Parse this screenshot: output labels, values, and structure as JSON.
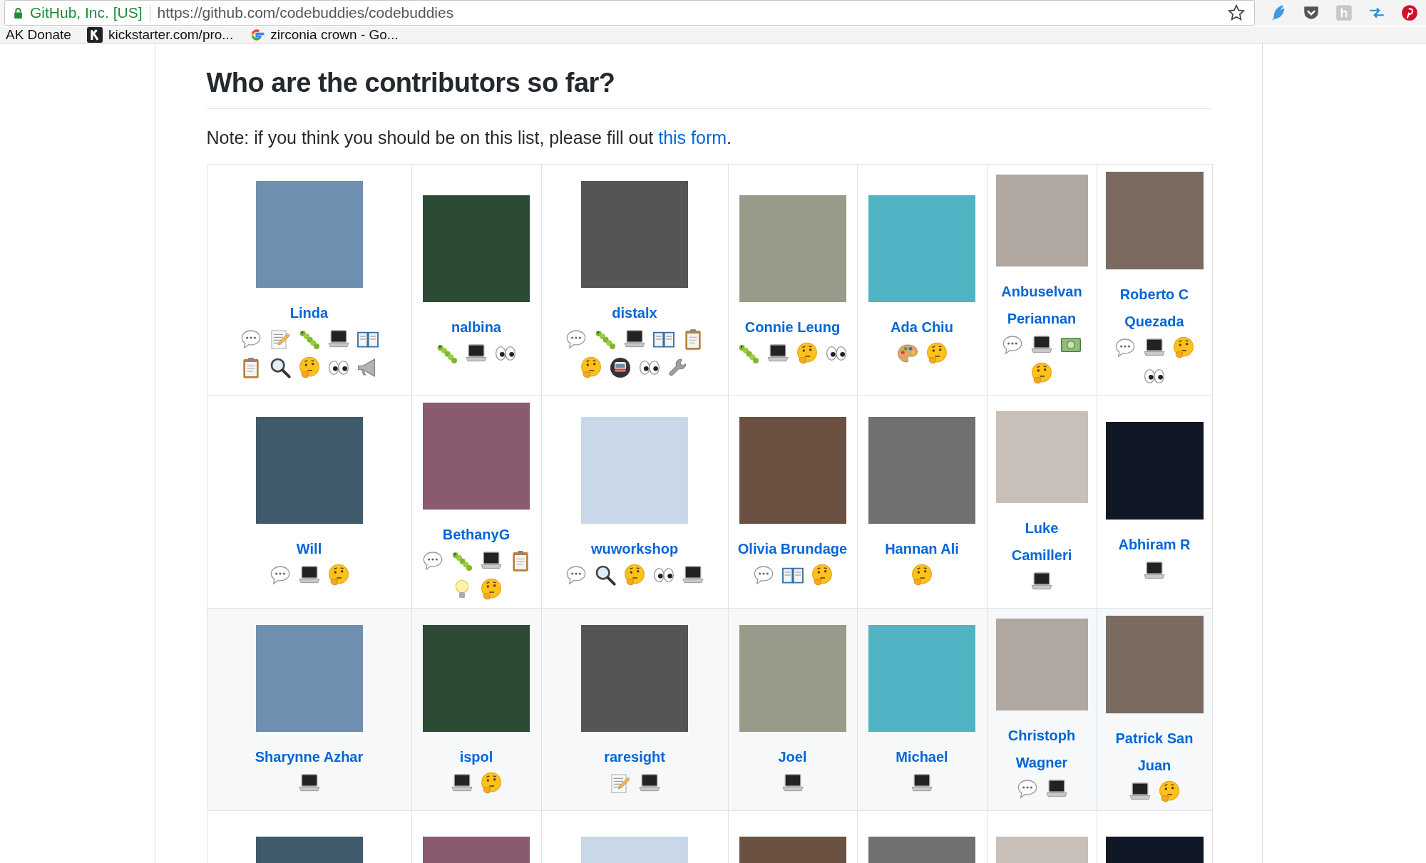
{
  "browser": {
    "site_identity": "GitHub, Inc. [US]",
    "url": "https://github.com/codebuddies/codebuddies",
    "bookmarks": [
      {
        "kind": "text",
        "label": "AK Donate"
      },
      {
        "kind": "kickstarter",
        "label": "kickstarter.com/pro..."
      },
      {
        "kind": "google",
        "label": "zirconia crown - Go..."
      }
    ]
  },
  "heading": "Who are the contributors so far?",
  "note": {
    "before": "Note: if you think you should be on this list, please fill out ",
    "link": "this form",
    "after": "."
  },
  "rows": [
    [
      {
        "name": "Linda",
        "contributions": [
          {
            "kind": "speech"
          },
          {
            "kind": "memo"
          },
          {
            "kind": "bug"
          },
          {
            "kind": "laptop"
          },
          {
            "kind": "book"
          },
          {
            "kind": "clipboard"
          },
          {
            "kind": "magnifier"
          },
          {
            "kind": "thinking"
          },
          {
            "kind": "eyes"
          },
          {
            "kind": "megaphone"
          }
        ]
      },
      {
        "name": "nalbina",
        "contributions": [
          {
            "kind": "bug"
          },
          {
            "kind": "laptop"
          },
          {
            "kind": "eyes"
          }
        ]
      },
      {
        "name": "distalx",
        "contributions": [
          {
            "kind": "speech"
          },
          {
            "kind": "bug"
          },
          {
            "kind": "laptop"
          },
          {
            "kind": "book"
          },
          {
            "kind": "clipboard"
          },
          {
            "kind": "thinking"
          },
          {
            "kind": "train"
          },
          {
            "kind": "eyes"
          },
          {
            "kind": "wrench"
          }
        ]
      },
      {
        "name": "Connie Leung",
        "contributions": [
          {
            "kind": "bug"
          },
          {
            "kind": "laptop"
          },
          {
            "kind": "thinking"
          },
          {
            "kind": "eyes"
          }
        ]
      },
      {
        "name": "Ada Chiu",
        "contributions": [
          {
            "kind": "palette"
          },
          {
            "kind": "thinking"
          }
        ]
      },
      {
        "name": "Anbuselvan Periannan",
        "contributions": [
          {
            "kind": "speech"
          },
          {
            "kind": "laptop"
          },
          {
            "kind": "money"
          },
          {
            "kind": "thinking"
          }
        ]
      },
      {
        "name": "Roberto C Quezada",
        "contributions": [
          {
            "kind": "speech"
          },
          {
            "kind": "laptop"
          },
          {
            "kind": "thinking"
          },
          {
            "kind": "eyes"
          }
        ]
      }
    ],
    [
      {
        "name": "Will",
        "contributions": [
          {
            "kind": "speech"
          },
          {
            "kind": "laptop"
          },
          {
            "kind": "thinking"
          }
        ]
      },
      {
        "name": "BethanyG",
        "contributions": [
          {
            "kind": "speech"
          },
          {
            "kind": "bug"
          },
          {
            "kind": "laptop"
          },
          {
            "kind": "clipboard"
          },
          {
            "kind": "bulb"
          },
          {
            "kind": "thinking"
          }
        ]
      },
      {
        "name": "wuworkshop",
        "contributions": [
          {
            "kind": "speech"
          },
          {
            "kind": "magnifier"
          },
          {
            "kind": "thinking"
          },
          {
            "kind": "eyes"
          },
          {
            "kind": "laptop"
          }
        ]
      },
      {
        "name": "Olivia Brundage",
        "contributions": [
          {
            "kind": "speech"
          },
          {
            "kind": "book"
          },
          {
            "kind": "thinking"
          }
        ]
      },
      {
        "name": "Hannan Ali",
        "contributions": [
          {
            "kind": "thinking"
          }
        ]
      },
      {
        "name": "Luke Camilleri",
        "contributions": [
          {
            "kind": "laptop"
          }
        ]
      },
      {
        "name": "Abhiram R",
        "contributions": [
          {
            "kind": "laptop"
          }
        ]
      }
    ],
    [
      {
        "name": "Sharynne Azhar",
        "contributions": [
          {
            "kind": "laptop"
          }
        ]
      },
      {
        "name": "ispol",
        "contributions": [
          {
            "kind": "laptop"
          },
          {
            "kind": "thinking"
          }
        ]
      },
      {
        "name": "raresight",
        "contributions": [
          {
            "kind": "memo"
          },
          {
            "kind": "laptop"
          }
        ]
      },
      {
        "name": "Joel",
        "contributions": [
          {
            "kind": "laptop"
          }
        ]
      },
      {
        "name": "Michael",
        "contributions": [
          {
            "kind": "laptop"
          }
        ]
      },
      {
        "name": "Christoph Wagner",
        "contributions": [
          {
            "kind": "speech"
          },
          {
            "kind": "laptop"
          }
        ]
      },
      {
        "name": "Patrick San Juan",
        "contributions": [
          {
            "kind": "laptop"
          },
          {
            "kind": "thinking"
          }
        ]
      }
    ],
    [
      {},
      {},
      {},
      {},
      {},
      {},
      {}
    ]
  ]
}
